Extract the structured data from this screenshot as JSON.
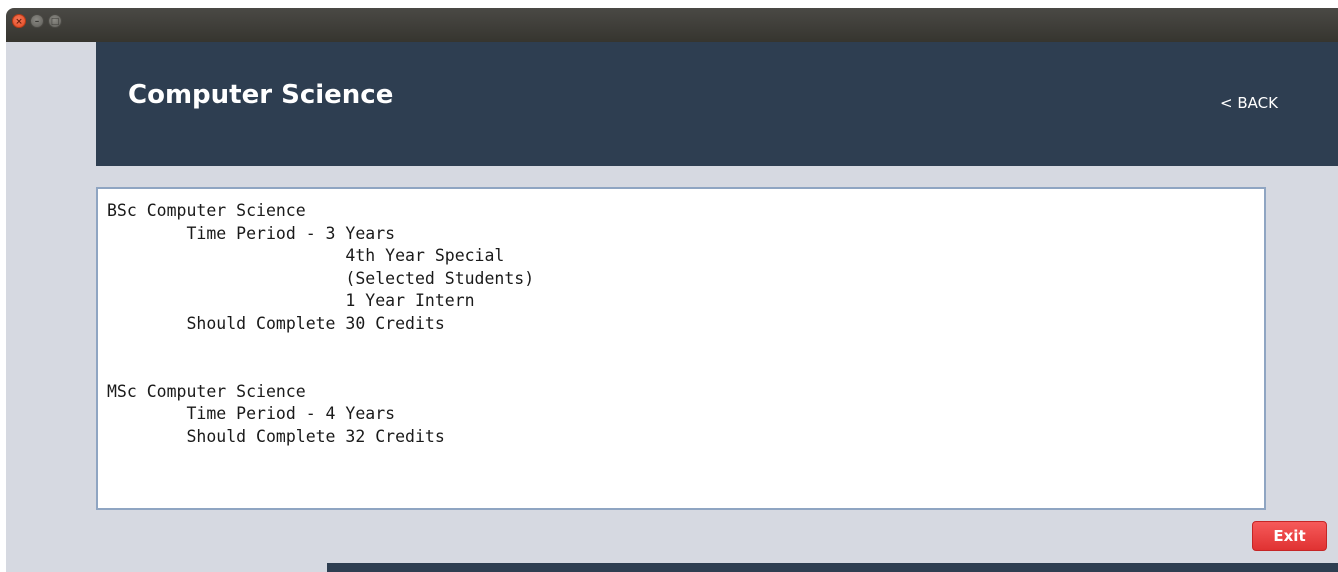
{
  "window": {
    "close_glyph": "×",
    "minimize_glyph": "–",
    "maximize_glyph": "□"
  },
  "header": {
    "title": "Computer Science",
    "back_label": "< BACK"
  },
  "details": {
    "text": "BSc Computer Science\n\tTime Period - 3 Years\n\t\t\t4th Year Special\n\t\t\t(Selected Students)\n\t\t\t1 Year Intern\n\tShould Complete 30 Credits\n\n\nMSc Computer Science\n\tTime Period - 4 Years\n\tShould Complete 32 Credits"
  },
  "actions": {
    "exit_label": "Exit"
  },
  "colors": {
    "header_bg": "#2e3e51",
    "content_bg": "#d6d9e1",
    "exit_button": "#ef4444",
    "textarea_border": "#8fa5c2"
  }
}
